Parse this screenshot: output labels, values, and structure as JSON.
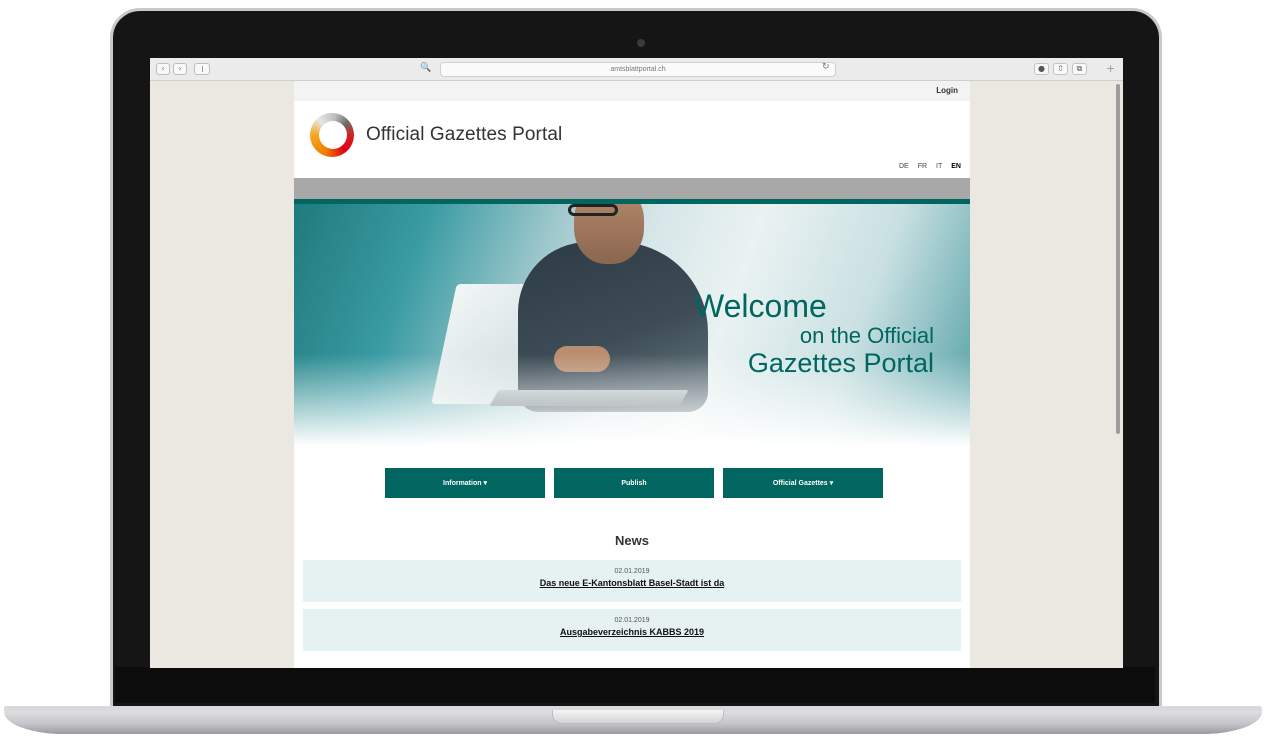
{
  "browser": {
    "nav_back": "‹",
    "nav_forward": "›",
    "url": "amtsblattportal.ch",
    "search_glyph": "🔍",
    "reload_glyph": "↻",
    "right_buttons": [
      "●",
      "⇧",
      "⧉"
    ],
    "new_tab_glyph": "+"
  },
  "header": {
    "login_label": "Login",
    "site_title": "Official Gazettes Portal",
    "languages": [
      {
        "code": "DE"
      },
      {
        "code": "FR"
      },
      {
        "code": "IT"
      },
      {
        "code": "EN",
        "active": true
      }
    ]
  },
  "hero": {
    "line1": "Welcome",
    "line2": "on the Official",
    "line3": "Gazettes Portal"
  },
  "buttons": {
    "information": "Information ▾",
    "publish": "Publish",
    "official_gazettes": "Official Gazettes ▾"
  },
  "news": {
    "heading": "News",
    "items": [
      {
        "date": "02.01.2019",
        "title": "Das neue E-Kantonsblatt Basel-Stadt ist da"
      },
      {
        "date": "02.01.2019",
        "title": "Ausgabeverzeichnis KABBS 2019"
      }
    ]
  },
  "colors": {
    "brand_teal": "#00665f",
    "news_bg": "#e6f1f1",
    "header_band": "#a8a8a8"
  }
}
